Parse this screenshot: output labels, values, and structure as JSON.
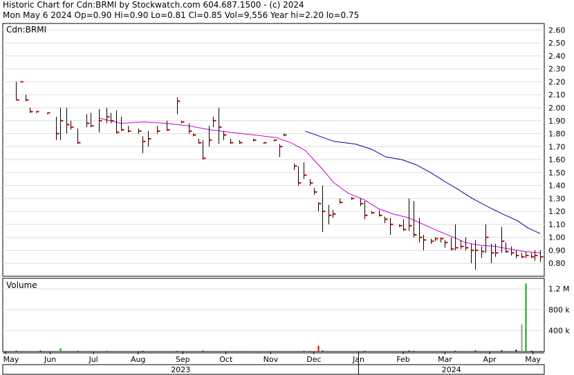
{
  "header": {
    "line1": "Historic Chart for Cdn:BRMI by Stockwatch.com 604.687.1500 - (c) 2024",
    "line2": "Mon May  6 2024  Op=0.90  Hi=0.90  Lo=0.81  Cl=0.85  Vol=9,556  Year hi=2.20  lo=0.75"
  },
  "colors": {
    "price_bar": "#000000",
    "close_tick": "#cc0000",
    "ma_short": "#cc00cc",
    "ma_long": "#0000aa",
    "volume": "#000000",
    "volume_high_red": "#cc0000",
    "volume_high_green": "#00aa00",
    "volume_recent_gray": "#999999"
  },
  "chart_data": [
    {
      "type": "line",
      "title": "Cdn:BRMI",
      "ylim": [
        0.7,
        2.65
      ],
      "ytick_labels": [
        "0.80",
        "0.90",
        "1.00",
        "1.10",
        "1.20",
        "1.30",
        "1.40",
        "1.50",
        "1.60",
        "1.70",
        "1.80",
        "1.90",
        "2.00",
        "2.10",
        "2.20",
        "2.30",
        "2.40",
        "2.50",
        "2.60"
      ],
      "x_month_labels": [
        "May",
        "Jun",
        "Jul",
        "Aug",
        "Sep",
        "Oct",
        "Nov",
        "Dec",
        "Jan",
        "Feb",
        "Mar",
        "Apr",
        "May"
      ],
      "x_year_labels": [
        "2023",
        "2024"
      ],
      "ohlc_bars": [
        {
          "date": "2023-05-08",
          "high": 2.2,
          "low": 2.06,
          "close": 2.06
        },
        {
          "date": "2023-05-11",
          "high": 2.2,
          "low": 2.2,
          "close": 2.2
        },
        {
          "date": "2023-05-15",
          "high": 2.1,
          "low": 2.05,
          "close": 2.06
        },
        {
          "date": "2023-05-18",
          "high": 2.0,
          "low": 1.96,
          "close": 1.97
        },
        {
          "date": "2023-05-22",
          "high": 1.97,
          "low": 1.96,
          "close": 1.97
        },
        {
          "date": "2023-05-30",
          "high": 1.96,
          "low": 1.95,
          "close": 1.96
        },
        {
          "date": "2023-06-05",
          "high": 1.93,
          "low": 1.75,
          "close": 1.8
        },
        {
          "date": "2023-06-08",
          "high": 2.0,
          "low": 1.75,
          "close": 1.9
        },
        {
          "date": "2023-06-12",
          "high": 2.0,
          "low": 1.8,
          "close": 1.87
        },
        {
          "date": "2023-06-15",
          "high": 1.9,
          "low": 1.83,
          "close": 1.85
        },
        {
          "date": "2023-06-20",
          "high": 1.84,
          "low": 1.72,
          "close": 1.73
        },
        {
          "date": "2023-06-26",
          "high": 1.95,
          "low": 1.85,
          "close": 1.88
        },
        {
          "date": "2023-06-29",
          "high": 1.96,
          "low": 1.85,
          "close": 1.86
        },
        {
          "date": "2023-07-05",
          "high": 1.99,
          "low": 1.81,
          "close": 1.9
        },
        {
          "date": "2023-07-10",
          "high": 2.0,
          "low": 1.88,
          "close": 1.93
        },
        {
          "date": "2023-07-13",
          "high": 1.96,
          "low": 1.88,
          "close": 1.9
        },
        {
          "date": "2023-07-17",
          "high": 1.98,
          "low": 1.8,
          "close": 1.81
        },
        {
          "date": "2023-07-20",
          "high": 1.93,
          "low": 1.82,
          "close": 1.83
        },
        {
          "date": "2023-07-25",
          "high": 1.86,
          "low": 1.81,
          "close": 1.82
        },
        {
          "date": "2023-08-01",
          "high": 1.84,
          "low": 1.8,
          "close": 1.82
        },
        {
          "date": "2023-08-04",
          "high": 1.78,
          "low": 1.65,
          "close": 1.74
        },
        {
          "date": "2023-08-08",
          "high": 1.82,
          "low": 1.7,
          "close": 1.76
        },
        {
          "date": "2023-08-14",
          "high": 1.86,
          "low": 1.8,
          "close": 1.82
        },
        {
          "date": "2023-08-21",
          "high": 1.9,
          "low": 1.82,
          "close": 1.83
        },
        {
          "date": "2023-08-28",
          "high": 2.08,
          "low": 1.95,
          "close": 2.05
        },
        {
          "date": "2023-08-31",
          "high": 1.9,
          "low": 1.88,
          "close": 1.89
        },
        {
          "date": "2023-09-05",
          "high": 1.88,
          "low": 1.8,
          "close": 1.82
        },
        {
          "date": "2023-09-08",
          "high": 1.8,
          "low": 1.78,
          "close": 1.79
        },
        {
          "date": "2023-09-12",
          "high": 1.76,
          "low": 1.72,
          "close": 1.73
        },
        {
          "date": "2023-09-15",
          "high": 1.75,
          "low": 1.6,
          "close": 1.61
        },
        {
          "date": "2023-09-19",
          "high": 1.86,
          "low": 1.7,
          "close": 1.75
        },
        {
          "date": "2023-09-22",
          "high": 1.93,
          "low": 1.85,
          "close": 1.9
        },
        {
          "date": "2023-09-26",
          "high": 2.0,
          "low": 1.72,
          "close": 1.85
        },
        {
          "date": "2023-09-29",
          "high": 1.82,
          "low": 1.75,
          "close": 1.79
        },
        {
          "date": "2023-10-04",
          "high": 1.76,
          "low": 1.72,
          "close": 1.73
        },
        {
          "date": "2023-10-10",
          "high": 1.75,
          "low": 1.72,
          "close": 1.73
        },
        {
          "date": "2023-10-20",
          "high": 1.76,
          "low": 1.74,
          "close": 1.75
        },
        {
          "date": "2023-10-27",
          "high": 1.73,
          "low": 1.72,
          "close": 1.73
        },
        {
          "date": "2023-11-03",
          "high": 1.75,
          "low": 1.74,
          "close": 1.75
        },
        {
          "date": "2023-11-07",
          "high": 1.72,
          "low": 1.62,
          "close": 1.7
        },
        {
          "date": "2023-11-10",
          "high": 1.8,
          "low": 1.78,
          "close": 1.79
        },
        {
          "date": "2023-11-17",
          "high": 1.57,
          "low": 1.52,
          "close": 1.55
        },
        {
          "date": "2023-11-20",
          "high": 1.55,
          "low": 1.4,
          "close": 1.42
        },
        {
          "date": "2023-11-24",
          "high": 1.58,
          "low": 1.45,
          "close": 1.48
        },
        {
          "date": "2023-11-28",
          "high": 1.45,
          "low": 1.4,
          "close": 1.42
        },
        {
          "date": "2023-12-01",
          "high": 1.38,
          "low": 1.33,
          "close": 1.35
        },
        {
          "date": "2023-12-04",
          "high": 1.27,
          "low": 1.2,
          "close": 1.26
        },
        {
          "date": "2023-12-07",
          "high": 1.4,
          "low": 1.04,
          "close": 1.2
        },
        {
          "date": "2023-12-11",
          "high": 1.25,
          "low": 1.1,
          "close": 1.17
        },
        {
          "date": "2023-12-14",
          "high": 1.21,
          "low": 1.15,
          "close": 1.18
        },
        {
          "date": "2023-12-19",
          "high": 1.3,
          "low": 1.26,
          "close": 1.27
        },
        {
          "date": "2023-12-27",
          "high": 1.31,
          "low": 1.29,
          "close": 1.3
        },
        {
          "date": "2024-01-02",
          "high": 1.3,
          "low": 1.24,
          "close": 1.26
        },
        {
          "date": "2024-01-05",
          "high": 1.28,
          "low": 1.14,
          "close": 1.17
        },
        {
          "date": "2024-01-10",
          "high": 1.2,
          "low": 1.18,
          "close": 1.19
        },
        {
          "date": "2024-01-15",
          "high": 1.21,
          "low": 1.16,
          "close": 1.17
        },
        {
          "date": "2024-01-19",
          "high": 1.16,
          "low": 1.11,
          "close": 1.14
        },
        {
          "date": "2024-01-23",
          "high": 1.15,
          "low": 1.02,
          "close": 1.1
        },
        {
          "date": "2024-01-29",
          "high": 1.1,
          "low": 1.08,
          "close": 1.09
        },
        {
          "date": "2024-02-01",
          "high": 1.14,
          "low": 1.05,
          "close": 1.06
        },
        {
          "date": "2024-02-05",
          "high": 1.3,
          "low": 1.05,
          "close": 1.09
        },
        {
          "date": "2024-02-08",
          "high": 1.28,
          "low": 1.0,
          "close": 1.02
        },
        {
          "date": "2024-02-12",
          "high": 1.15,
          "low": 0.96,
          "close": 1.0
        },
        {
          "date": "2024-02-15",
          "high": 1.02,
          "low": 0.9,
          "close": 0.98
        },
        {
          "date": "2024-02-20",
          "high": 0.99,
          "low": 0.95,
          "close": 0.97
        },
        {
          "date": "2024-02-23",
          "high": 1.0,
          "low": 0.97,
          "close": 0.99
        },
        {
          "date": "2024-02-27",
          "high": 1.0,
          "low": 0.96,
          "close": 0.99
        },
        {
          "date": "2024-03-01",
          "high": 0.98,
          "low": 0.92,
          "close": 0.96
        },
        {
          "date": "2024-03-05",
          "high": 1.0,
          "low": 0.9,
          "close": 0.91
        },
        {
          "date": "2024-03-08",
          "high": 1.1,
          "low": 0.9,
          "close": 0.92
        },
        {
          "date": "2024-03-12",
          "high": 0.98,
          "low": 0.91,
          "close": 0.93
        },
        {
          "date": "2024-03-15",
          "high": 1.0,
          "low": 0.9,
          "close": 0.92
        },
        {
          "date": "2024-03-19",
          "high": 0.95,
          "low": 0.8,
          "close": 0.9
        },
        {
          "date": "2024-03-22",
          "high": 0.98,
          "low": 0.75,
          "close": 0.9
        },
        {
          "date": "2024-03-26",
          "high": 0.93,
          "low": 0.84,
          "close": 0.89
        },
        {
          "date": "2024-03-29",
          "high": 1.1,
          "low": 0.88,
          "close": 1.0
        },
        {
          "date": "2024-04-02",
          "high": 0.95,
          "low": 0.8,
          "close": 0.88
        },
        {
          "date": "2024-04-05",
          "high": 0.95,
          "low": 0.85,
          "close": 0.88
        },
        {
          "date": "2024-04-09",
          "high": 1.08,
          "low": 0.88,
          "close": 0.97
        },
        {
          "date": "2024-04-12",
          "high": 0.96,
          "low": 0.88,
          "close": 0.89
        },
        {
          "date": "2024-04-16",
          "high": 0.93,
          "low": 0.86,
          "close": 0.88
        },
        {
          "date": "2024-04-19",
          "high": 0.9,
          "low": 0.84,
          "close": 0.86
        },
        {
          "date": "2024-04-23",
          "high": 0.88,
          "low": 0.84,
          "close": 0.85
        },
        {
          "date": "2024-04-26",
          "high": 0.89,
          "low": 0.84,
          "close": 0.86
        },
        {
          "date": "2024-04-30",
          "high": 0.88,
          "low": 0.84,
          "close": 0.85
        },
        {
          "date": "2024-05-02",
          "high": 0.9,
          "low": 0.82,
          "close": 0.86
        },
        {
          "date": "2024-05-06",
          "high": 0.9,
          "low": 0.81,
          "close": 0.85
        }
      ],
      "series": [
        {
          "key": "ma_short",
          "points": [
            [
              "2023-07-05",
              1.92
            ],
            [
              "2023-07-20",
              1.88
            ],
            [
              "2023-08-05",
              1.89
            ],
            [
              "2023-08-20",
              1.88
            ],
            [
              "2023-09-05",
              1.86
            ],
            [
              "2023-09-20",
              1.83
            ],
            [
              "2023-10-05",
              1.81
            ],
            [
              "2023-10-20",
              1.79
            ],
            [
              "2023-11-05",
              1.77
            ],
            [
              "2023-11-15",
              1.73
            ],
            [
              "2023-11-25",
              1.67
            ],
            [
              "2023-12-05",
              1.55
            ],
            [
              "2023-12-15",
              1.42
            ],
            [
              "2023-12-25",
              1.34
            ],
            [
              "2024-01-05",
              1.29
            ],
            [
              "2024-01-15",
              1.22
            ],
            [
              "2024-01-25",
              1.18
            ],
            [
              "2024-02-05",
              1.15
            ],
            [
              "2024-02-15",
              1.1
            ],
            [
              "2024-02-25",
              1.05
            ],
            [
              "2024-03-05",
              1.01
            ],
            [
              "2024-03-15",
              0.96
            ],
            [
              "2024-03-25",
              0.94
            ],
            [
              "2024-04-05",
              0.93
            ],
            [
              "2024-04-15",
              0.91
            ],
            [
              "2024-04-25",
              0.89
            ],
            [
              "2024-05-06",
              0.88
            ]
          ]
        },
        {
          "key": "ma_long",
          "points": [
            [
              "2023-11-25",
              1.82
            ],
            [
              "2023-12-05",
              1.78
            ],
            [
              "2023-12-15",
              1.74
            ],
            [
              "2023-12-30",
              1.72
            ],
            [
              "2024-01-10",
              1.68
            ],
            [
              "2024-01-20",
              1.62
            ],
            [
              "2024-01-31",
              1.6
            ],
            [
              "2024-02-10",
              1.56
            ],
            [
              "2024-02-20",
              1.5
            ],
            [
              "2024-03-01",
              1.43
            ],
            [
              "2024-03-10",
              1.37
            ],
            [
              "2024-03-20",
              1.3
            ],
            [
              "2024-03-30",
              1.24
            ],
            [
              "2024-04-10",
              1.18
            ],
            [
              "2024-04-20",
              1.13
            ],
            [
              "2024-04-28",
              1.07
            ],
            [
              "2024-05-06",
              1.03
            ]
          ]
        }
      ]
    },
    {
      "type": "bar",
      "title": "Volume",
      "ylim": [
        0,
        1400000
      ],
      "ytick_labels": [
        "400 k",
        "800 k",
        "1.2 M"
      ],
      "volume_bars": [
        {
          "date": "2023-05-08",
          "value": 15000,
          "color_key": "volume"
        },
        {
          "date": "2023-05-25",
          "value": 18000,
          "color_key": "volume"
        },
        {
          "date": "2023-06-08",
          "value": 60000,
          "color_key": "volume_high_green"
        },
        {
          "date": "2023-06-20",
          "value": 12000,
          "color_key": "volume"
        },
        {
          "date": "2023-07-10",
          "value": 10000,
          "color_key": "volume"
        },
        {
          "date": "2023-08-04",
          "value": 14000,
          "color_key": "volume"
        },
        {
          "date": "2023-08-28",
          "value": 12000,
          "color_key": "volume"
        },
        {
          "date": "2023-09-15",
          "value": 16000,
          "color_key": "volume"
        },
        {
          "date": "2023-10-10",
          "value": 8000,
          "color_key": "volume"
        },
        {
          "date": "2023-11-03",
          "value": 8000,
          "color_key": "volume"
        },
        {
          "date": "2023-11-24",
          "value": 12000,
          "color_key": "volume"
        },
        {
          "date": "2023-11-28",
          "value": 10000,
          "color_key": "volume"
        },
        {
          "date": "2023-12-04",
          "value": 110000,
          "color_key": "volume_high_red"
        },
        {
          "date": "2023-12-07",
          "value": 20000,
          "color_key": "volume"
        },
        {
          "date": "2024-01-05",
          "value": 15000,
          "color_key": "volume"
        },
        {
          "date": "2024-02-05",
          "value": 18000,
          "color_key": "volume"
        },
        {
          "date": "2024-02-08",
          "value": 12000,
          "color_key": "volume"
        },
        {
          "date": "2024-03-08",
          "value": 15000,
          "color_key": "volume"
        },
        {
          "date": "2024-03-22",
          "value": 20000,
          "color_key": "volume"
        },
        {
          "date": "2024-04-09",
          "value": 22000,
          "color_key": "volume"
        },
        {
          "date": "2024-04-19",
          "value": 35000,
          "color_key": "volume"
        },
        {
          "date": "2024-04-23",
          "value": 520000,
          "color_key": "volume_recent_gray"
        },
        {
          "date": "2024-04-26",
          "value": 1300000,
          "color_key": "volume_high_green"
        },
        {
          "date": "2024-04-30",
          "value": 15000,
          "color_key": "volume"
        },
        {
          "date": "2024-05-06",
          "value": 9556,
          "color_key": "volume"
        }
      ]
    }
  ]
}
